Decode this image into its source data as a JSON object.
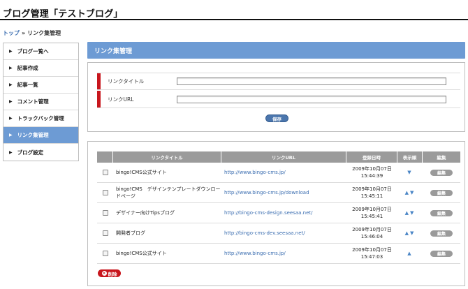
{
  "page": {
    "title": "ブログ管理「テストブログ」"
  },
  "breadcrumb": {
    "home": "トップ",
    "separator": "»",
    "current": "リンク集管理"
  },
  "sidebar": {
    "items": [
      {
        "label": "ブログ一覧へ"
      },
      {
        "label": "記事作成"
      },
      {
        "label": "記事一覧"
      },
      {
        "label": "コメント管理"
      },
      {
        "label": "トラックバック管理"
      },
      {
        "label": "リンク集管理",
        "active": true
      },
      {
        "label": "ブログ設定"
      }
    ]
  },
  "main": {
    "heading": "リンク集管理"
  },
  "form": {
    "title_label": "リンクタイトル",
    "title_value": "",
    "url_label": "リンクURL",
    "url_value": "",
    "save_label": "保存"
  },
  "table": {
    "headers": [
      "",
      "リンクタイトル",
      "リンクURL",
      "登録日時",
      "表示順",
      "編集"
    ],
    "rows": [
      {
        "title": "bingo!CMS公式サイト",
        "url": "http://www.bingo-cms.jp/",
        "date": "2009年10月07日",
        "time": "15:44:39",
        "order": "▼",
        "edit": "編集"
      },
      {
        "title": "bingo!CMS　デザインテンプレートダウンロードページ",
        "url": "http://www.bingo-cms.jp/download",
        "date": "2009年10月07日",
        "time": "15:45:11",
        "order": "▲▼",
        "edit": "編集"
      },
      {
        "title": "デザイナー向けTipsブログ",
        "url": "http://bingo-cms-design.seesaa.net/",
        "date": "2009年10月07日",
        "time": "15:45:41",
        "order": "▲▼",
        "edit": "編集"
      },
      {
        "title": "開発者ブログ",
        "url": "http://bingo-cms-dev.seesaa.net/",
        "date": "2009年10月07日",
        "time": "15:46:04",
        "order": "▲▼",
        "edit": "編集"
      },
      {
        "title": "bingo!CMS公式サイト",
        "url": "http://www.bingo-cms.jp/",
        "date": "2009年10月07日",
        "time": "15:47:03",
        "order": "▲",
        "edit": "編集"
      }
    ],
    "delete_label": "削除",
    "delete_icon": "×"
  },
  "colors": {
    "accent": "#6d9bd4",
    "danger": "#c8161d",
    "link": "#3a6db0"
  }
}
